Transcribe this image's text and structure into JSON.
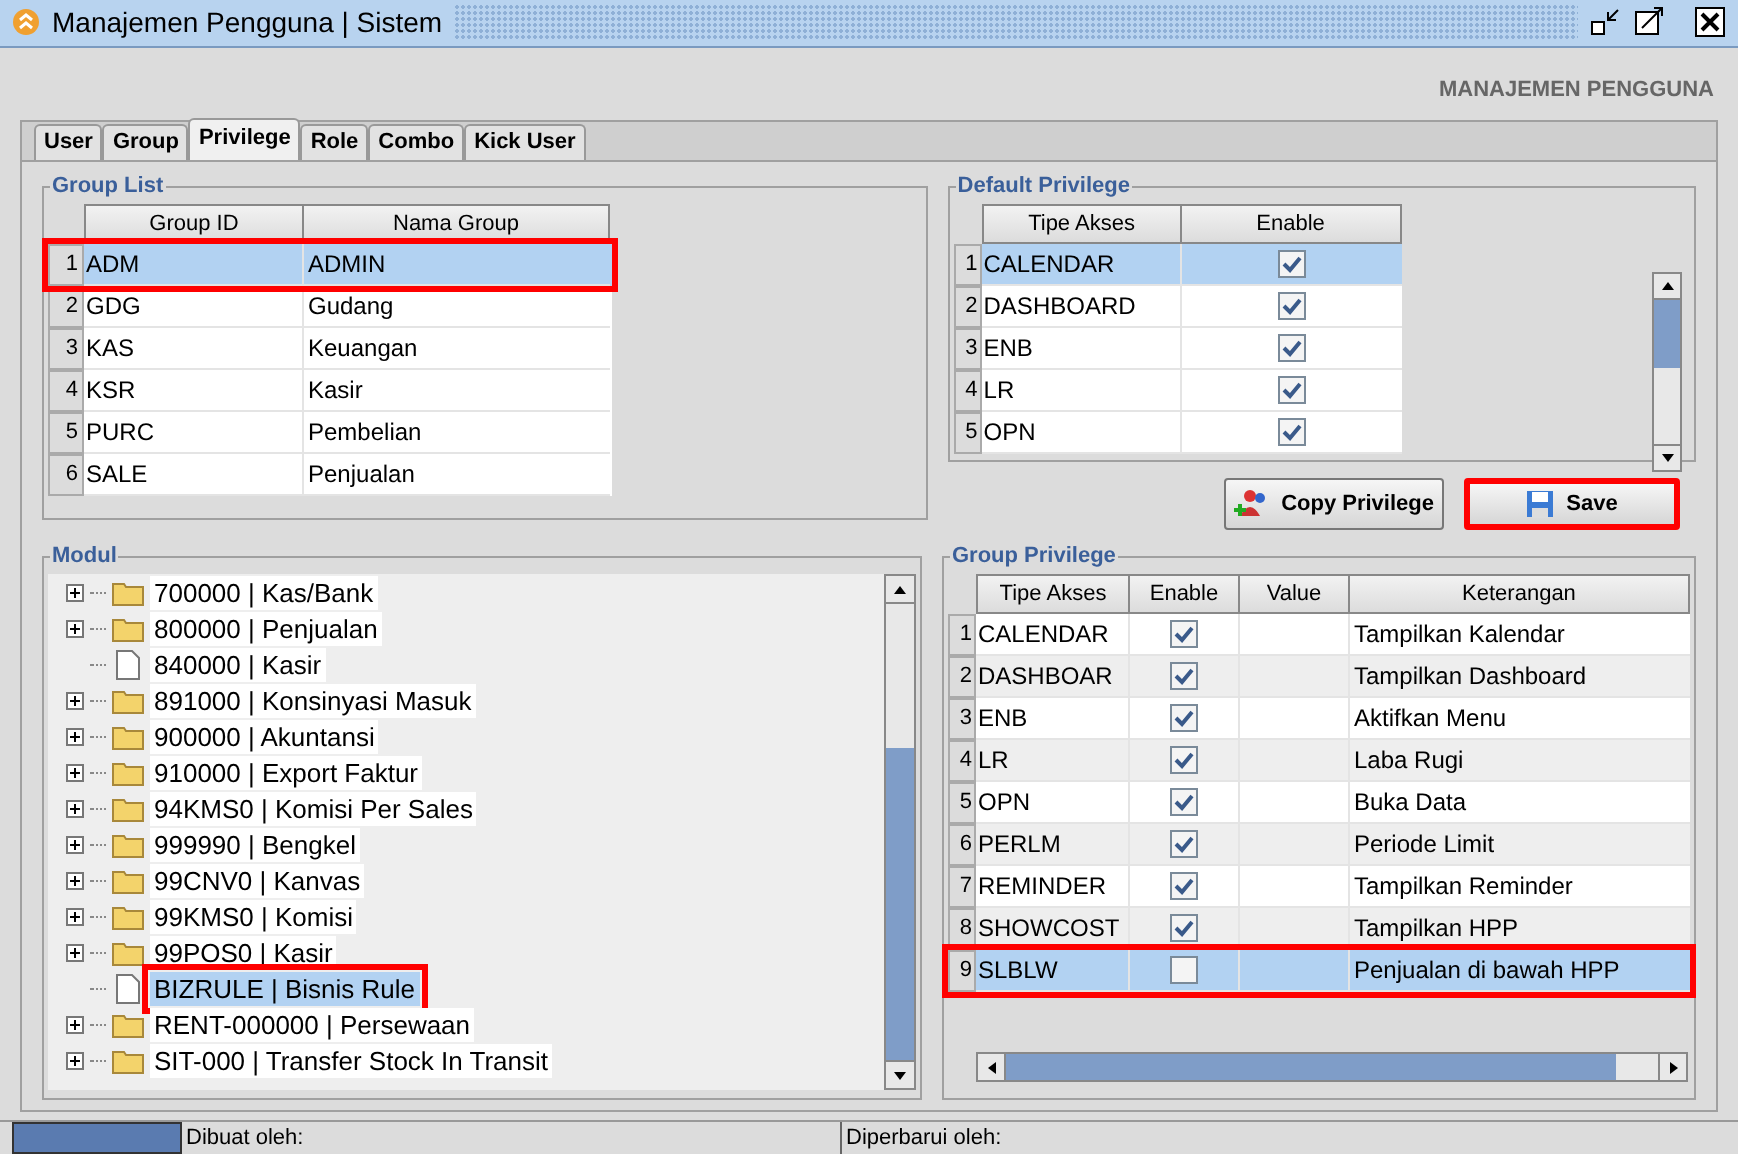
{
  "window": {
    "title": "Manajemen Pengguna | Sistem"
  },
  "header": "MANAJEMEN PENGGUNA",
  "tabs": [
    {
      "label": "User",
      "selected": false
    },
    {
      "label": "Group",
      "selected": false
    },
    {
      "label": "Privilege",
      "selected": true
    },
    {
      "label": "Role",
      "selected": false
    },
    {
      "label": "Combo",
      "selected": false
    },
    {
      "label": "Kick User",
      "selected": false
    }
  ],
  "group_list": {
    "title": "Group List",
    "columns": [
      "Group ID",
      "Nama Group"
    ],
    "rows": [
      {
        "num": "1",
        "id": "ADM",
        "name": "ADMIN",
        "selected": true,
        "annotated": true
      },
      {
        "num": "2",
        "id": "GDG",
        "name": "Gudang",
        "selected": false,
        "annotated": false
      },
      {
        "num": "3",
        "id": "KAS",
        "name": "Keuangan",
        "selected": false,
        "annotated": false
      },
      {
        "num": "4",
        "id": "KSR",
        "name": "Kasir",
        "selected": false,
        "annotated": false
      },
      {
        "num": "5",
        "id": "PURC",
        "name": "Pembelian",
        "selected": false,
        "annotated": false
      },
      {
        "num": "6",
        "id": "SALE",
        "name": "Penjualan",
        "selected": false,
        "annotated": false
      }
    ]
  },
  "default_privilege": {
    "title": "Default Privilege",
    "columns": [
      "Tipe Akses",
      "Enable"
    ],
    "rows": [
      {
        "num": "1",
        "type": "CALENDAR",
        "checked": true,
        "selected": true
      },
      {
        "num": "2",
        "type": "DASHBOARD",
        "checked": true,
        "selected": false
      },
      {
        "num": "3",
        "type": "ENB",
        "checked": true,
        "selected": false
      },
      {
        "num": "4",
        "type": "LR",
        "checked": true,
        "selected": false
      },
      {
        "num": "5",
        "type": "OPN",
        "checked": true,
        "selected": false
      }
    ]
  },
  "buttons": [
    {
      "label": "Copy Privilege",
      "kind": "copy",
      "annotated": false
    },
    {
      "label": "Save",
      "kind": "save",
      "annotated": true
    }
  ],
  "modul": {
    "title": "Modul",
    "items": [
      {
        "label": "700000 | Kas/Bank",
        "kind": "folder",
        "selected": false,
        "annotated": false
      },
      {
        "label": "800000 | Penjualan",
        "kind": "folder",
        "selected": false,
        "annotated": false
      },
      {
        "label": "840000 | Kasir",
        "kind": "file",
        "selected": false,
        "annotated": false
      },
      {
        "label": "891000 | Konsinyasi Masuk",
        "kind": "folder",
        "selected": false,
        "annotated": false
      },
      {
        "label": "900000 | Akuntansi",
        "kind": "folder",
        "selected": false,
        "annotated": false
      },
      {
        "label": "910000 | Export Faktur",
        "kind": "folder",
        "selected": false,
        "annotated": false
      },
      {
        "label": "94KMS0 | Komisi Per Sales",
        "kind": "folder",
        "selected": false,
        "annotated": false
      },
      {
        "label": "999990 | Bengkel",
        "kind": "folder",
        "selected": false,
        "annotated": false
      },
      {
        "label": "99CNV0 | Kanvas",
        "kind": "folder",
        "selected": false,
        "annotated": false
      },
      {
        "label": "99KMS0 | Komisi",
        "kind": "folder",
        "selected": false,
        "annotated": false
      },
      {
        "label": "99POS0 | Kasir",
        "kind": "folder",
        "selected": false,
        "annotated": false
      },
      {
        "label": "BIZRULE | Bisnis Rule",
        "kind": "file",
        "selected": true,
        "annotated": true
      },
      {
        "label": "RENT-000000 | Persewaan",
        "kind": "folder",
        "selected": false,
        "annotated": false
      },
      {
        "label": "SIT-000 | Transfer Stock In Transit",
        "kind": "folder",
        "selected": false,
        "annotated": false
      }
    ]
  },
  "group_privilege": {
    "title": "Group Privilege",
    "columns": [
      "Tipe Akses",
      "Enable",
      "Value",
      "Keterangan"
    ],
    "rows": [
      {
        "num": "1",
        "type": "CALENDAR",
        "checked": true,
        "description": "Tampilkan Kalendar",
        "selected": false,
        "annotated": false
      },
      {
        "num": "2",
        "type": "DASHBOAR",
        "checked": true,
        "description": "Tampilkan Dashboard",
        "selected": false,
        "annotated": false
      },
      {
        "num": "3",
        "type": "ENB",
        "checked": true,
        "description": "Aktifkan Menu",
        "selected": false,
        "annotated": false
      },
      {
        "num": "4",
        "type": "LR",
        "checked": true,
        "description": "Laba Rugi",
        "selected": false,
        "annotated": false
      },
      {
        "num": "5",
        "type": "OPN",
        "checked": true,
        "description": "Buka Data",
        "selected": false,
        "annotated": false
      },
      {
        "num": "6",
        "type": "PERLM",
        "checked": true,
        "description": "Periode Limit",
        "selected": false,
        "annotated": false
      },
      {
        "num": "7",
        "type": "REMINDER",
        "checked": true,
        "description": "Tampilkan Reminder",
        "selected": false,
        "annotated": false
      },
      {
        "num": "8",
        "type": "SHOWCOST",
        "checked": true,
        "description": "Tampilkan HPP",
        "selected": false,
        "annotated": false
      },
      {
        "num": "9",
        "type": "SLBLW",
        "checked": false,
        "description": "Penjualan di bawah HPP",
        "selected": true,
        "annotated": true
      }
    ]
  },
  "status_bar": [
    "Dibuat oleh:",
    "Diperbarui oleh:"
  ]
}
